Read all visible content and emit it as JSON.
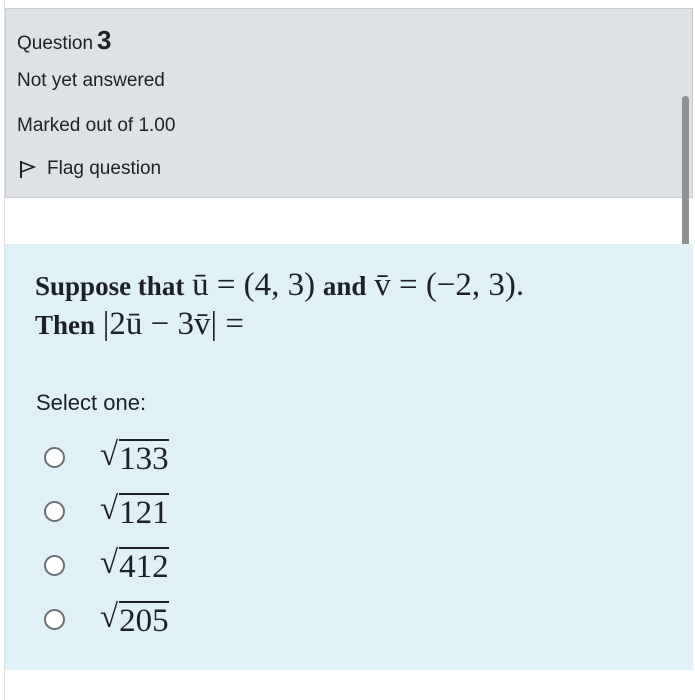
{
  "info": {
    "question_prefix": "Question",
    "question_number": "3",
    "state": "Not yet answered",
    "grade": "Marked out of 1.00",
    "flag_label": "Flag question"
  },
  "question": {
    "text_part1": "Suppose that",
    "u_eq": "ū = (4, 3)",
    "text_and": "and",
    "v_eq": "v̄ = (−2, 3).",
    "text_then": "Then",
    "expr": "|2ū − 3v̄| ="
  },
  "prompt": "Select one:",
  "options": [
    {
      "radical": "√",
      "radicand": "133"
    },
    {
      "radical": "√",
      "radicand": "121"
    },
    {
      "radical": "√",
      "radicand": "412"
    },
    {
      "radical": "√",
      "radicand": "205"
    }
  ],
  "colors": {
    "info_bg": "#dee2e6",
    "formulation_bg": "#dff0f6",
    "text": "#1d2125"
  }
}
